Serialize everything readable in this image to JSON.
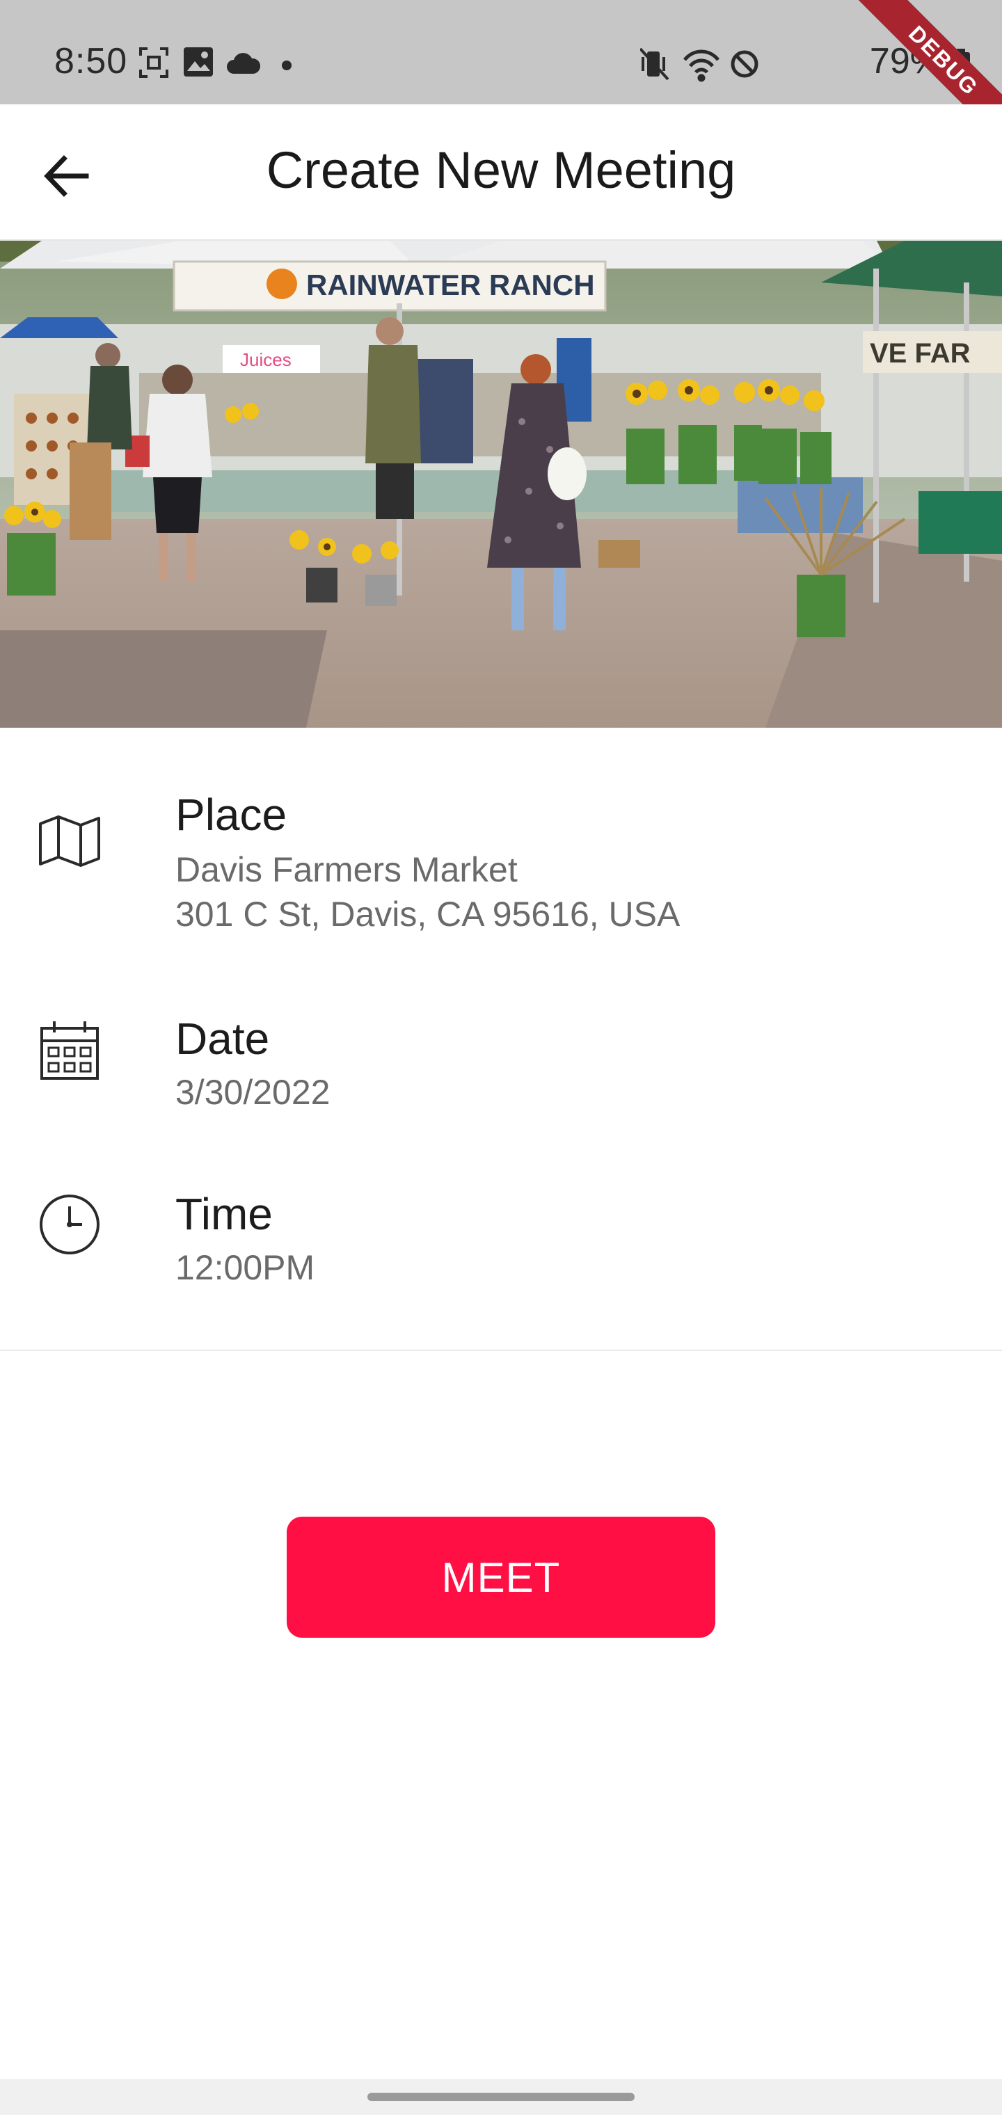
{
  "status_bar": {
    "time": "8:50",
    "battery": "79%",
    "icons": [
      "screenshot-icon",
      "gallery-icon",
      "cloud-icon",
      "dot-icon",
      "mute-vibrate-icon",
      "wifi-icon",
      "do-not-disturb-icon",
      "battery-icon"
    ],
    "debug_label": "DEBUG"
  },
  "app_bar": {
    "title": "Create New Meeting",
    "back_icon": "arrow-left-icon"
  },
  "hero": {
    "banner_text": "RAINWATER RANCH",
    "sign_text": "VE FAR",
    "juices_text": "Juices"
  },
  "details": {
    "place": {
      "label": "Place",
      "name": "Davis Farmers Market",
      "address": "301 C St, Davis, CA 95616, USA",
      "icon": "map-icon"
    },
    "date": {
      "label": "Date",
      "value": "3/30/2022",
      "icon": "calendar-icon"
    },
    "time": {
      "label": "Time",
      "value": "12:00PM",
      "icon": "clock-icon"
    }
  },
  "actions": {
    "meet_label": "MEET"
  },
  "colors": {
    "accent": "#ff0f43",
    "status_bar": "#c6c6c6",
    "debug_ribbon": "#a8242f"
  }
}
